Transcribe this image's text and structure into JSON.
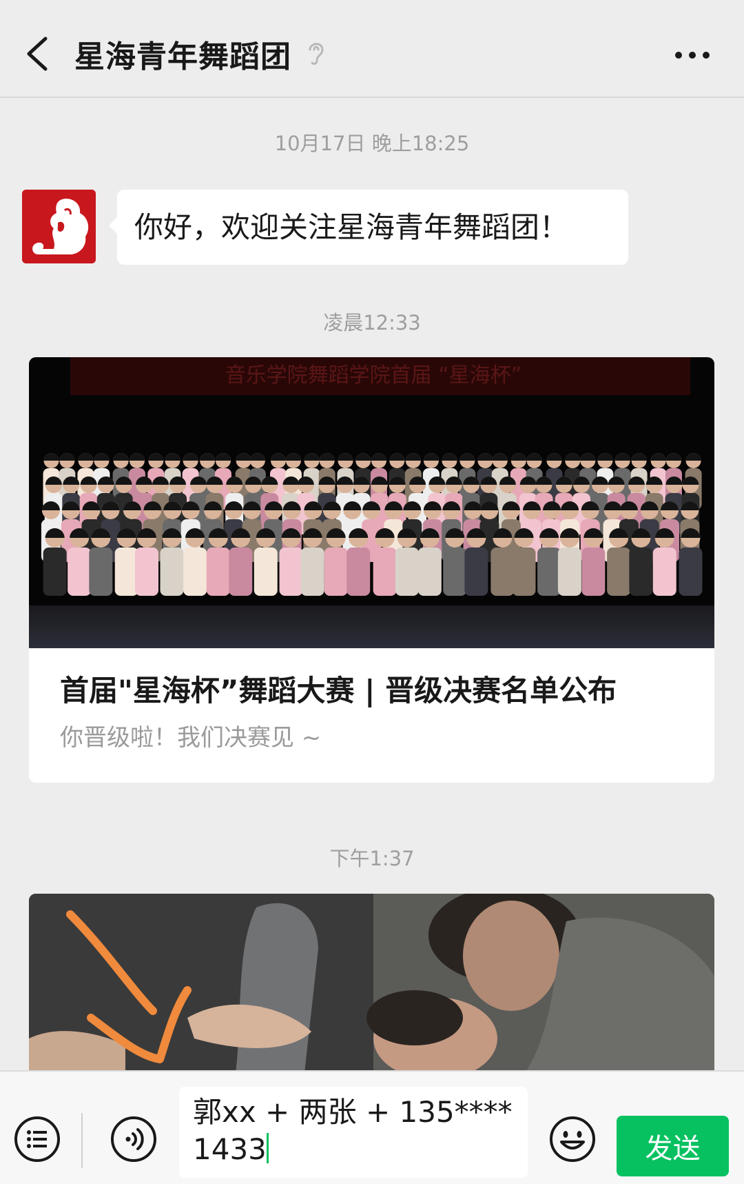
{
  "header": {
    "title": "星海青年舞蹈团"
  },
  "messages": {
    "time_1": "10月17日 晚上18:25",
    "welcome_text": "你好，欢迎关注星海青年舞蹈团！",
    "time_2": "凌晨12:33",
    "article": {
      "title": "首届\"星海杯”舞蹈大赛 | 晋级决赛名单公布",
      "subtitle": "你晋级啦！我们决赛见 ~",
      "banner_text": "音乐学院舞蹈学院首届 “星海杯”"
    },
    "time_3": "下午1:37"
  },
  "input_bar": {
    "text_value": "郭xx + 两张 + 135****1433",
    "send_label": "发送"
  },
  "colors": {
    "accent": "#07c160",
    "avatar_red": "#c8171d",
    "arrow_orange": "#f08a3c"
  }
}
